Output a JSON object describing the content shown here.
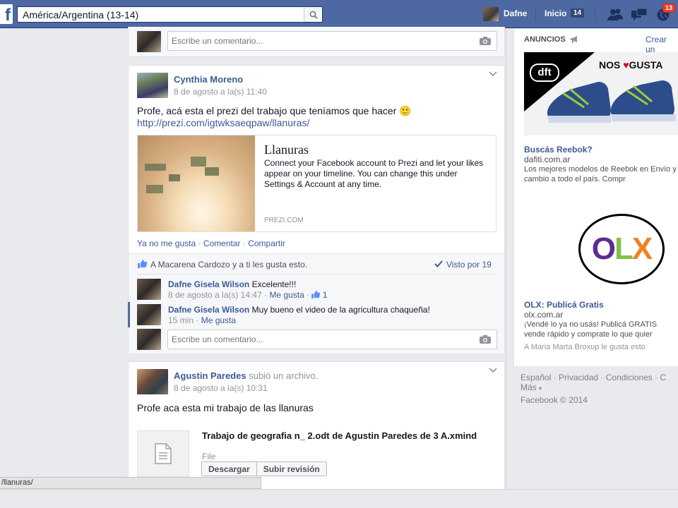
{
  "topbar": {
    "logo": "f",
    "search_value": "América/Argentina (13-14)",
    "user_name": "Dafne",
    "home_label": "Inicio",
    "home_count": "14",
    "notifications_count": "13",
    "icons": [
      "search-icon",
      "friends-icon",
      "messages-icon",
      "globe-icon"
    ]
  },
  "top_comment": {
    "placeholder": "Escribe un comentario..."
  },
  "post1": {
    "author": "Cynthia Moreno",
    "date": "8 de agosto a la(s) 11:40",
    "text": "Profe, acá esta el prezi del trabajo que teníamos que hacer 🙂",
    "link": "http://prezi.com/igtwksaeqpaw/llanuras/",
    "attachment": {
      "title": "Llanuras",
      "description": "Connect your Facebook account to Prezi and let your likes appear on your timeline. You can change this under Settings & Account at any time.",
      "source": "PREZI.COM"
    },
    "actions": [
      "Ya no me gusta",
      "Comentar",
      "Compartir"
    ],
    "likes_text": "A Macarena Cardozo y a ti les gusta esto.",
    "seen_by": "Visto por 19",
    "comments": [
      {
        "author": "Dafne Gisela Wilson",
        "text": "Excelente!!!",
        "date": "8 de agosto a la(s) 14:47",
        "action": "Me gusta",
        "likes": "1"
      },
      {
        "author": "Dafne Gisela Wilson",
        "text": "Muy bueno el video de la agricultura chaqueña!",
        "date": "15 min",
        "action": "Me gusta"
      }
    ],
    "comment_placeholder": "Escribe un comentario..."
  },
  "post2": {
    "author": "Agustin Paredes",
    "action_text": "subió un archivo.",
    "date": "8 de agosto a la(s) 10:31",
    "text": "Profe aca esta mi trabajo de las llanuras",
    "file_title": "Trabajo de geografia n_ 2.odt de Agustin Paredes de 3 A.xmind",
    "file_type": "File",
    "download_label": "Descargar",
    "revision_label": "Subir revisión"
  },
  "status_url": "/llanuras/",
  "rail": {
    "ads_label": "ANUNCIOS",
    "create_label": "Crear un",
    "ad1": {
      "brand": "dft",
      "banner_text": "NOS",
      "banner_text2": "GUSTA",
      "title": "Buscás Reebok?",
      "domain": "dafiti.com.ar",
      "desc": "Los mejores modelos de Reebok en Envío y cambio a todo el país. Compr"
    },
    "ad2": {
      "logo": "OLX",
      "title": "OLX: Publicá Gratis",
      "domain": "olx.com.ar",
      "desc": "¡Vendé lo ya no usás! Publicá GRATIS vende rápido y comprate lo que quier",
      "social": "A Maria Marta Broxup le gusta esto"
    },
    "footer_links": [
      "Español",
      "Privacidad",
      "Condiciones",
      "C"
    ],
    "more_label": "Más",
    "copyright": "Facebook © 2014"
  },
  "colors": {
    "topbar": "#4e69a2",
    "link": "#3b5998",
    "badge": "#f03d25",
    "olx_purple": "#5c2d91",
    "olx_green": "#7dc242",
    "olx_orange": "#f48120"
  }
}
